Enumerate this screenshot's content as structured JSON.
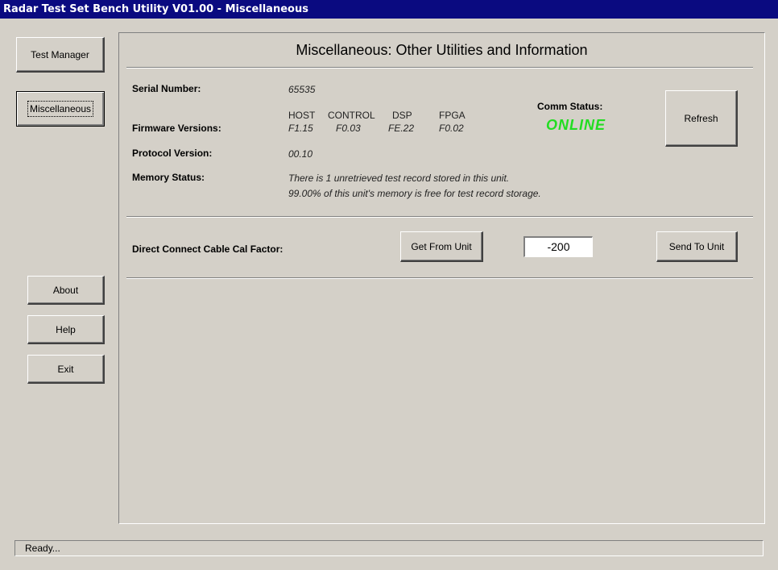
{
  "window": {
    "title": "Radar Test Set Bench Utility V01.00 - Miscellaneous"
  },
  "nav": {
    "test_manager": "Test Manager",
    "miscellaneous": "Miscellaneous",
    "about": "About",
    "help": "Help",
    "exit": "Exit"
  },
  "main": {
    "heading": "Miscellaneous: Other Utilities and Information",
    "serial_label": "Serial Number:",
    "serial_value": "65535",
    "firmware_label": "Firmware Versions:",
    "firmware": [
      {
        "name": "HOST",
        "version": "F1.15"
      },
      {
        "name": "CONTROL",
        "version": "F0.03"
      },
      {
        "name": "DSP",
        "version": "FE.22"
      },
      {
        "name": "FPGA",
        "version": "F0.02"
      }
    ],
    "comm_status_label": "Comm Status:",
    "comm_status_value": "ONLINE",
    "refresh": "Refresh",
    "protocol_label": "Protocol Version:",
    "protocol_value": "00.10",
    "memory_label": "Memory Status:",
    "memory_line1": "There is 1 unretrieved test record stored in this unit.",
    "memory_line2": "99.00% of this unit's memory is free for test record storage.",
    "cal_label": "Direct Connect Cable Cal Factor:",
    "get_from_unit": "Get From Unit",
    "cal_value": "-200",
    "send_to_unit": "Send To Unit"
  },
  "status_bar": {
    "text": "Ready..."
  },
  "colors": {
    "online": "#22dd22",
    "titlebar": "#0a0a80",
    "face": "#d4d0c8"
  }
}
